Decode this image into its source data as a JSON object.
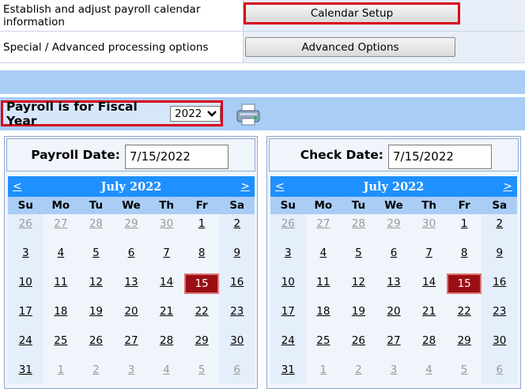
{
  "options": [
    {
      "label": "Establish and adjust payroll calendar information",
      "button": "Calendar Setup"
    },
    {
      "label": "Special / Advanced processing options",
      "button": "Advanced Options"
    }
  ],
  "fiscal_year": {
    "label": "Payroll is for Fiscal Year",
    "value": "2022"
  },
  "payroll_date": {
    "label": "Payroll Date:",
    "value": "7/15/2022"
  },
  "check_date": {
    "label": "Check Date:",
    "value": "7/15/2022"
  },
  "calendar": {
    "title": "July 2022",
    "prev": "<",
    "next": ">",
    "dow": [
      "Su",
      "Mo",
      "Tu",
      "We",
      "Th",
      "Fr",
      "Sa"
    ],
    "weeks": [
      [
        "26",
        "27",
        "28",
        "29",
        "30",
        "1",
        "2"
      ],
      [
        "3",
        "4",
        "5",
        "6",
        "7",
        "8",
        "9"
      ],
      [
        "10",
        "11",
        "12",
        "13",
        "14",
        "15",
        "16"
      ],
      [
        "17",
        "18",
        "19",
        "20",
        "21",
        "22",
        "23"
      ],
      [
        "24",
        "25",
        "26",
        "27",
        "28",
        "29",
        "30"
      ],
      [
        "31",
        "1",
        "2",
        "3",
        "4",
        "5",
        "6"
      ]
    ],
    "selected": "15"
  },
  "colors": {
    "accent_red": "#d9001b",
    "header_blue": "#1e90ff",
    "band_blue": "#a9cdf5",
    "selected_day": "#9b0e14"
  }
}
